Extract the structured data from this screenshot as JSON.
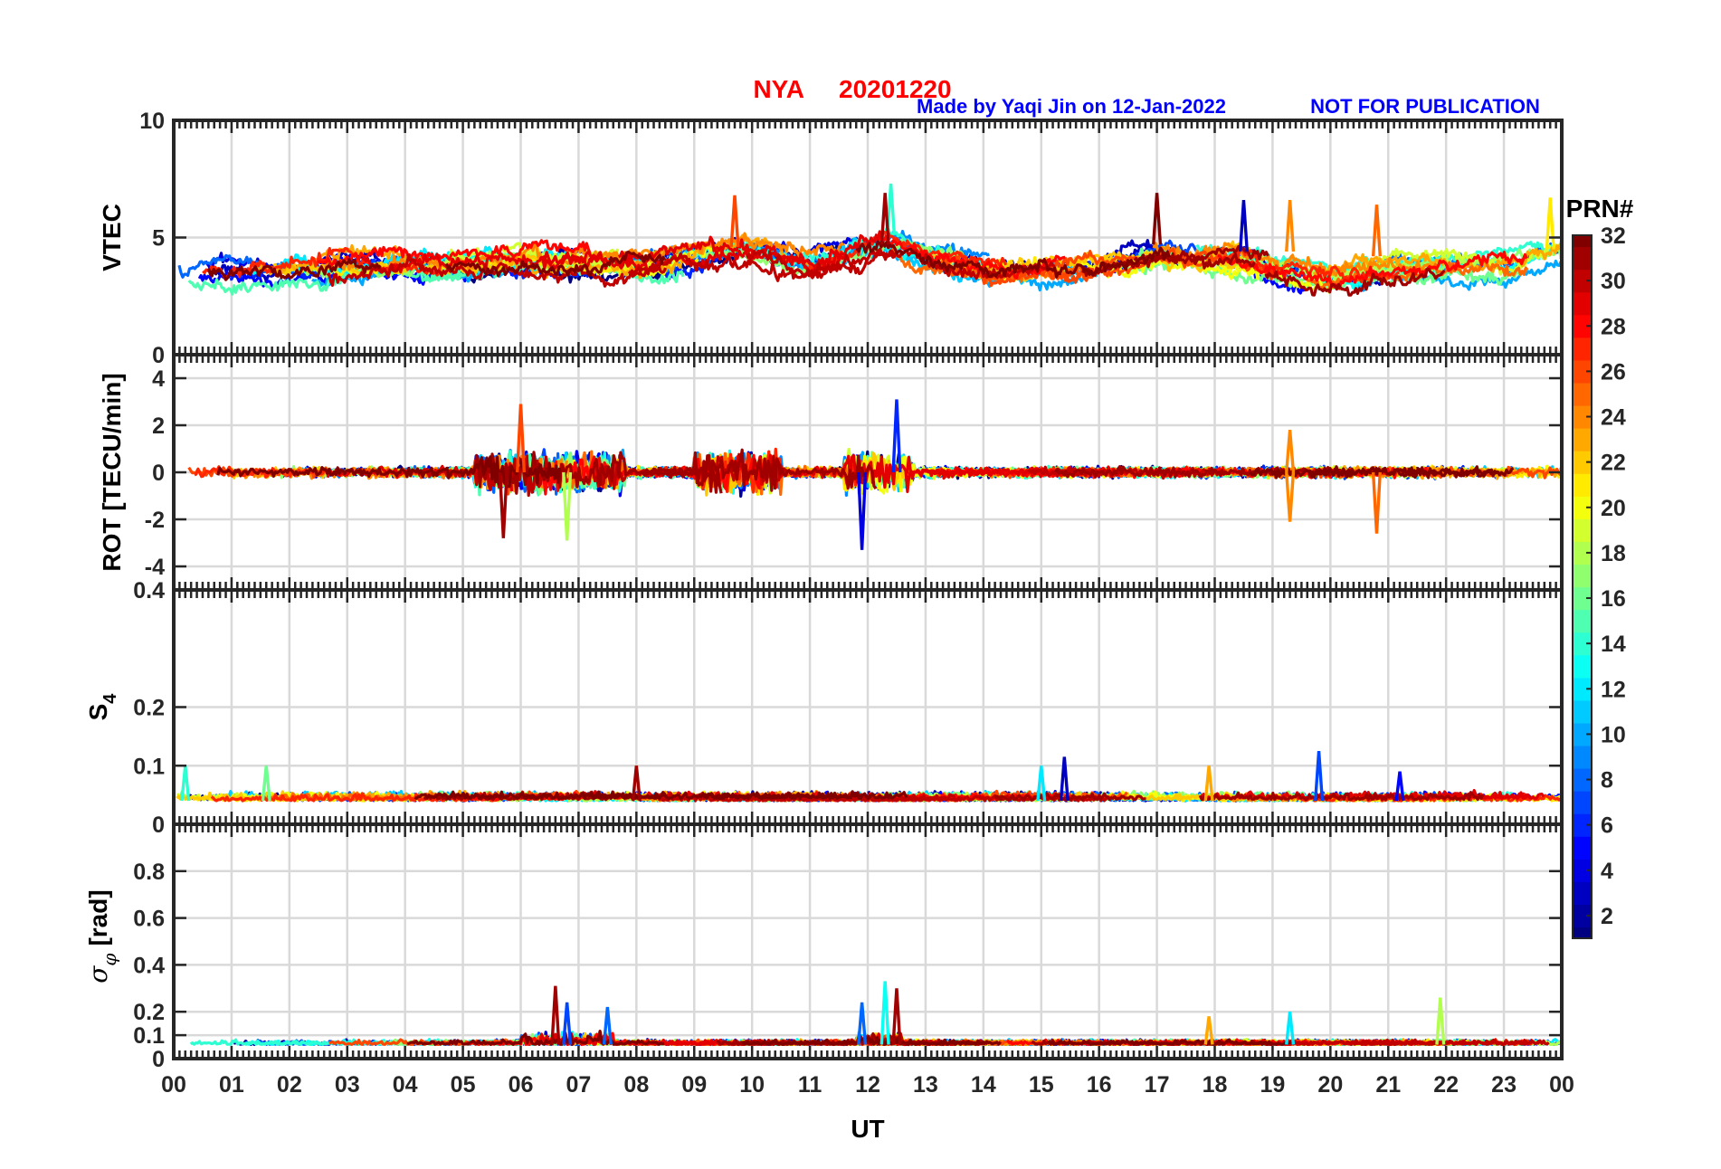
{
  "title": {
    "station": "NYA",
    "date": "20201220"
  },
  "credit": {
    "made_by": "Made by Yaqi Jin on 12-Jan-2022",
    "notice": "NOT FOR PUBLICATION"
  },
  "colorbar": {
    "label": "PRN#",
    "range": [
      1,
      32
    ],
    "tick_values": [
      2,
      4,
      6,
      8,
      10,
      12,
      14,
      16,
      18,
      20,
      22,
      24,
      26,
      28,
      30,
      32
    ],
    "tick_labels": [
      "2",
      "4",
      "6",
      "8",
      "10",
      "12",
      "14",
      "16",
      "18",
      "20",
      "22",
      "24",
      "26",
      "28",
      "30",
      "32"
    ],
    "colormap": "jet"
  },
  "x_axis": {
    "label": "UT",
    "range": [
      0,
      24
    ],
    "tick_values": [
      0,
      1,
      2,
      3,
      4,
      5,
      6,
      7,
      8,
      9,
      10,
      11,
      12,
      13,
      14,
      15,
      16,
      17,
      18,
      19,
      20,
      21,
      22,
      23,
      24
    ],
    "tick_labels": [
      "00",
      "01",
      "02",
      "03",
      "04",
      "05",
      "06",
      "07",
      "08",
      "09",
      "10",
      "11",
      "12",
      "13",
      "14",
      "15",
      "16",
      "17",
      "18",
      "19",
      "20",
      "21",
      "22",
      "23",
      "00"
    ]
  },
  "chart_data": [
    {
      "type": "line",
      "panel": "vtec",
      "ylabel": "VTEC",
      "ylim": [
        0,
        10
      ],
      "yticks": [
        0,
        5,
        10
      ],
      "ytick_labels": [
        "0",
        "5",
        "10"
      ],
      "grid": true,
      "series_note": "one line per GPS satellite PRN 1-32, colored by PRN",
      "envelope": {
        "x": [
          0,
          2,
          4,
          6,
          8,
          9.8,
          11,
          12.3,
          14,
          16,
          17,
          18.5,
          20,
          21,
          23,
          24
        ],
        "typical": [
          3.5,
          3.6,
          3.8,
          4.0,
          3.8,
          4.5,
          3.8,
          4.8,
          3.6,
          3.8,
          4.3,
          4.0,
          3.2,
          3.6,
          3.8,
          4.2
        ]
      },
      "peaks": [
        {
          "x": 9.7,
          "y": 6.8,
          "prn": 26
        },
        {
          "x": 12.4,
          "y": 7.3,
          "prn": 14
        },
        {
          "x": 12.3,
          "y": 6.9,
          "prn": 31
        },
        {
          "x": 17.0,
          "y": 6.9,
          "prn": 32
        },
        {
          "x": 18.5,
          "y": 6.6,
          "prn": 3
        },
        {
          "x": 19.3,
          "y": 6.6,
          "prn": 24
        },
        {
          "x": 20.8,
          "y": 6.4,
          "prn": 25
        },
        {
          "x": 23.8,
          "y": 6.7,
          "prn": 21
        }
      ]
    },
    {
      "type": "line",
      "panel": "rot",
      "ylabel": "ROT [TECU/min]",
      "ylim": [
        -5,
        5
      ],
      "yticks": [
        -4,
        -2,
        0,
        2,
        4
      ],
      "ytick_labels": [
        "-4",
        "-2",
        "0",
        "2",
        "4"
      ],
      "grid": true,
      "series_note": "one line per GPS satellite PRN 1-32, colored by PRN",
      "peaks": [
        {
          "x": 6.0,
          "y": 2.9,
          "prn": 26
        },
        {
          "x": 5.7,
          "y": -2.8,
          "prn": 31
        },
        {
          "x": 6.8,
          "y": -2.9,
          "prn": 18
        },
        {
          "x": 12.5,
          "y": 3.1,
          "prn": 6
        },
        {
          "x": 11.9,
          "y": -3.3,
          "prn": 4
        },
        {
          "x": 19.3,
          "y": 1.8,
          "prn": 24
        },
        {
          "x": 19.3,
          "y": -2.1,
          "prn": 24
        },
        {
          "x": 20.8,
          "y": -2.6,
          "prn": 25
        }
      ]
    },
    {
      "type": "line",
      "panel": "s4",
      "ylabel": "S4",
      "ylim": [
        0,
        0.4
      ],
      "yticks": [
        0,
        0.1,
        0.2,
        0.4
      ],
      "ytick_labels": [
        "0",
        "0.1",
        "0.2",
        "0.4"
      ],
      "grid": true,
      "series_note": "one line per GPS satellite PRN 1-32, colored by PRN",
      "baseline": 0.04,
      "peaks": [
        {
          "x": 0.2,
          "y": 0.1,
          "prn": 14
        },
        {
          "x": 1.6,
          "y": 0.1,
          "prn": 16
        },
        {
          "x": 8.0,
          "y": 0.1,
          "prn": 31
        },
        {
          "x": 15.4,
          "y": 0.115,
          "prn": 3
        },
        {
          "x": 15.0,
          "y": 0.1,
          "prn": 12
        },
        {
          "x": 17.9,
          "y": 0.1,
          "prn": 23
        },
        {
          "x": 19.8,
          "y": 0.125,
          "prn": 7
        },
        {
          "x": 21.2,
          "y": 0.09,
          "prn": 5
        }
      ]
    },
    {
      "type": "line",
      "panel": "sigma_phi",
      "ylabel": "σ_φ [rad]",
      "ylim": [
        0,
        1
      ],
      "yticks": [
        0,
        0.1,
        0.2,
        0.4,
        0.6,
        0.8
      ],
      "ytick_labels": [
        "0",
        "0.1",
        "0.2",
        "0.4",
        "0.6",
        "0.8"
      ],
      "grid": true,
      "series_note": "one line per GPS satellite PRN 1-32, colored by PRN",
      "baseline": 0.06,
      "peaks": [
        {
          "x": 6.6,
          "y": 0.31,
          "prn": 31
        },
        {
          "x": 6.8,
          "y": 0.24,
          "prn": 7
        },
        {
          "x": 7.5,
          "y": 0.22,
          "prn": 8
        },
        {
          "x": 11.9,
          "y": 0.24,
          "prn": 8
        },
        {
          "x": 12.3,
          "y": 0.33,
          "prn": 13
        },
        {
          "x": 12.5,
          "y": 0.3,
          "prn": 31
        },
        {
          "x": 17.9,
          "y": 0.18,
          "prn": 23
        },
        {
          "x": 19.3,
          "y": 0.2,
          "prn": 12
        },
        {
          "x": 21.9,
          "y": 0.26,
          "prn": 18
        }
      ]
    }
  ]
}
